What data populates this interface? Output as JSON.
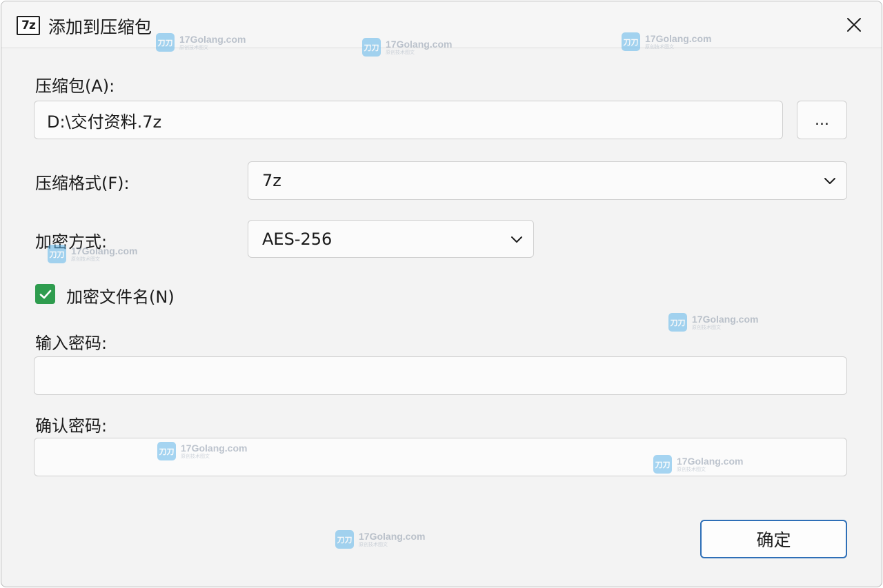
{
  "window": {
    "title": "添加到压缩包",
    "app_icon_text": "7z"
  },
  "archive": {
    "label": "压缩包(A):",
    "value": "D:\\交付资料.7z",
    "browse_label": "..."
  },
  "format": {
    "label": "压缩格式(F):",
    "selected": "7z"
  },
  "encryption": {
    "label": "加密方式:",
    "selected": "AES-256"
  },
  "encrypt_names": {
    "label": "加密文件名(N)",
    "checked": true
  },
  "password": {
    "label": "输入密码:",
    "value": ""
  },
  "confirm_password": {
    "label": "确认密码:",
    "value": ""
  },
  "ok_button": {
    "label": "确定"
  },
  "watermark": {
    "logo_text": "刀刀",
    "name": "17Golang.com",
    "subtitle": "原创技术图文"
  },
  "colors": {
    "checkbox": "#2e9c4e",
    "ok_border": "#2e6fb7",
    "watermark_logo": "#5fb6ea"
  }
}
